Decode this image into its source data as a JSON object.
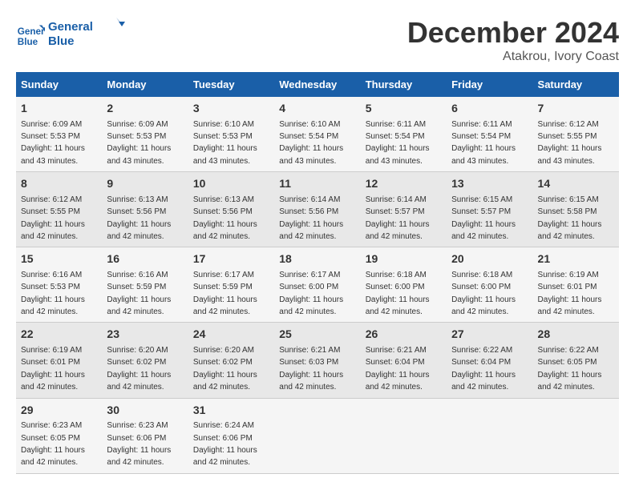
{
  "header": {
    "logo_line1": "General",
    "logo_line2": "Blue",
    "month": "December 2024",
    "location": "Atakrou, Ivory Coast"
  },
  "days_of_week": [
    "Sunday",
    "Monday",
    "Tuesday",
    "Wednesday",
    "Thursday",
    "Friday",
    "Saturday"
  ],
  "weeks": [
    [
      {
        "day": "1",
        "sunrise": "Sunrise: 6:09 AM",
        "sunset": "Sunset: 5:53 PM",
        "daylight": "Daylight: 11 hours and 43 minutes."
      },
      {
        "day": "2",
        "sunrise": "Sunrise: 6:09 AM",
        "sunset": "Sunset: 5:53 PM",
        "daylight": "Daylight: 11 hours and 43 minutes."
      },
      {
        "day": "3",
        "sunrise": "Sunrise: 6:10 AM",
        "sunset": "Sunset: 5:53 PM",
        "daylight": "Daylight: 11 hours and 43 minutes."
      },
      {
        "day": "4",
        "sunrise": "Sunrise: 6:10 AM",
        "sunset": "Sunset: 5:54 PM",
        "daylight": "Daylight: 11 hours and 43 minutes."
      },
      {
        "day": "5",
        "sunrise": "Sunrise: 6:11 AM",
        "sunset": "Sunset: 5:54 PM",
        "daylight": "Daylight: 11 hours and 43 minutes."
      },
      {
        "day": "6",
        "sunrise": "Sunrise: 6:11 AM",
        "sunset": "Sunset: 5:54 PM",
        "daylight": "Daylight: 11 hours and 43 minutes."
      },
      {
        "day": "7",
        "sunrise": "Sunrise: 6:12 AM",
        "sunset": "Sunset: 5:55 PM",
        "daylight": "Daylight: 11 hours and 43 minutes."
      }
    ],
    [
      {
        "day": "8",
        "sunrise": "Sunrise: 6:12 AM",
        "sunset": "Sunset: 5:55 PM",
        "daylight": "Daylight: 11 hours and 42 minutes."
      },
      {
        "day": "9",
        "sunrise": "Sunrise: 6:13 AM",
        "sunset": "Sunset: 5:56 PM",
        "daylight": "Daylight: 11 hours and 42 minutes."
      },
      {
        "day": "10",
        "sunrise": "Sunrise: 6:13 AM",
        "sunset": "Sunset: 5:56 PM",
        "daylight": "Daylight: 11 hours and 42 minutes."
      },
      {
        "day": "11",
        "sunrise": "Sunrise: 6:14 AM",
        "sunset": "Sunset: 5:56 PM",
        "daylight": "Daylight: 11 hours and 42 minutes."
      },
      {
        "day": "12",
        "sunrise": "Sunrise: 6:14 AM",
        "sunset": "Sunset: 5:57 PM",
        "daylight": "Daylight: 11 hours and 42 minutes."
      },
      {
        "day": "13",
        "sunrise": "Sunrise: 6:15 AM",
        "sunset": "Sunset: 5:57 PM",
        "daylight": "Daylight: 11 hours and 42 minutes."
      },
      {
        "day": "14",
        "sunrise": "Sunrise: 6:15 AM",
        "sunset": "Sunset: 5:58 PM",
        "daylight": "Daylight: 11 hours and 42 minutes."
      }
    ],
    [
      {
        "day": "15",
        "sunrise": "Sunrise: 6:16 AM",
        "sunset": "Sunset: 5:53 PM",
        "daylight": "Daylight: 11 hours and 42 minutes."
      },
      {
        "day": "16",
        "sunrise": "Sunrise: 6:16 AM",
        "sunset": "Sunset: 5:59 PM",
        "daylight": "Daylight: 11 hours and 42 minutes."
      },
      {
        "day": "17",
        "sunrise": "Sunrise: 6:17 AM",
        "sunset": "Sunset: 5:59 PM",
        "daylight": "Daylight: 11 hours and 42 minutes."
      },
      {
        "day": "18",
        "sunrise": "Sunrise: 6:17 AM",
        "sunset": "Sunset: 6:00 PM",
        "daylight": "Daylight: 11 hours and 42 minutes."
      },
      {
        "day": "19",
        "sunrise": "Sunrise: 6:18 AM",
        "sunset": "Sunset: 6:00 PM",
        "daylight": "Daylight: 11 hours and 42 minutes."
      },
      {
        "day": "20",
        "sunrise": "Sunrise: 6:18 AM",
        "sunset": "Sunset: 6:00 PM",
        "daylight": "Daylight: 11 hours and 42 minutes."
      },
      {
        "day": "21",
        "sunrise": "Sunrise: 6:19 AM",
        "sunset": "Sunset: 6:01 PM",
        "daylight": "Daylight: 11 hours and 42 minutes."
      }
    ],
    [
      {
        "day": "22",
        "sunrise": "Sunrise: 6:19 AM",
        "sunset": "Sunset: 6:01 PM",
        "daylight": "Daylight: 11 hours and 42 minutes."
      },
      {
        "day": "23",
        "sunrise": "Sunrise: 6:20 AM",
        "sunset": "Sunset: 6:02 PM",
        "daylight": "Daylight: 11 hours and 42 minutes."
      },
      {
        "day": "24",
        "sunrise": "Sunrise: 6:20 AM",
        "sunset": "Sunset: 6:02 PM",
        "daylight": "Daylight: 11 hours and 42 minutes."
      },
      {
        "day": "25",
        "sunrise": "Sunrise: 6:21 AM",
        "sunset": "Sunset: 6:03 PM",
        "daylight": "Daylight: 11 hours and 42 minutes."
      },
      {
        "day": "26",
        "sunrise": "Sunrise: 6:21 AM",
        "sunset": "Sunset: 6:04 PM",
        "daylight": "Daylight: 11 hours and 42 minutes."
      },
      {
        "day": "27",
        "sunrise": "Sunrise: 6:22 AM",
        "sunset": "Sunset: 6:04 PM",
        "daylight": "Daylight: 11 hours and 42 minutes."
      },
      {
        "day": "28",
        "sunrise": "Sunrise: 6:22 AM",
        "sunset": "Sunset: 6:05 PM",
        "daylight": "Daylight: 11 hours and 42 minutes."
      }
    ],
    [
      {
        "day": "29",
        "sunrise": "Sunrise: 6:23 AM",
        "sunset": "Sunset: 6:05 PM",
        "daylight": "Daylight: 11 hours and 42 minutes."
      },
      {
        "day": "30",
        "sunrise": "Sunrise: 6:23 AM",
        "sunset": "Sunset: 6:06 PM",
        "daylight": "Daylight: 11 hours and 42 minutes."
      },
      {
        "day": "31",
        "sunrise": "Sunrise: 6:24 AM",
        "sunset": "Sunset: 6:06 PM",
        "daylight": "Daylight: 11 hours and 42 minutes."
      },
      null,
      null,
      null,
      null
    ]
  ]
}
